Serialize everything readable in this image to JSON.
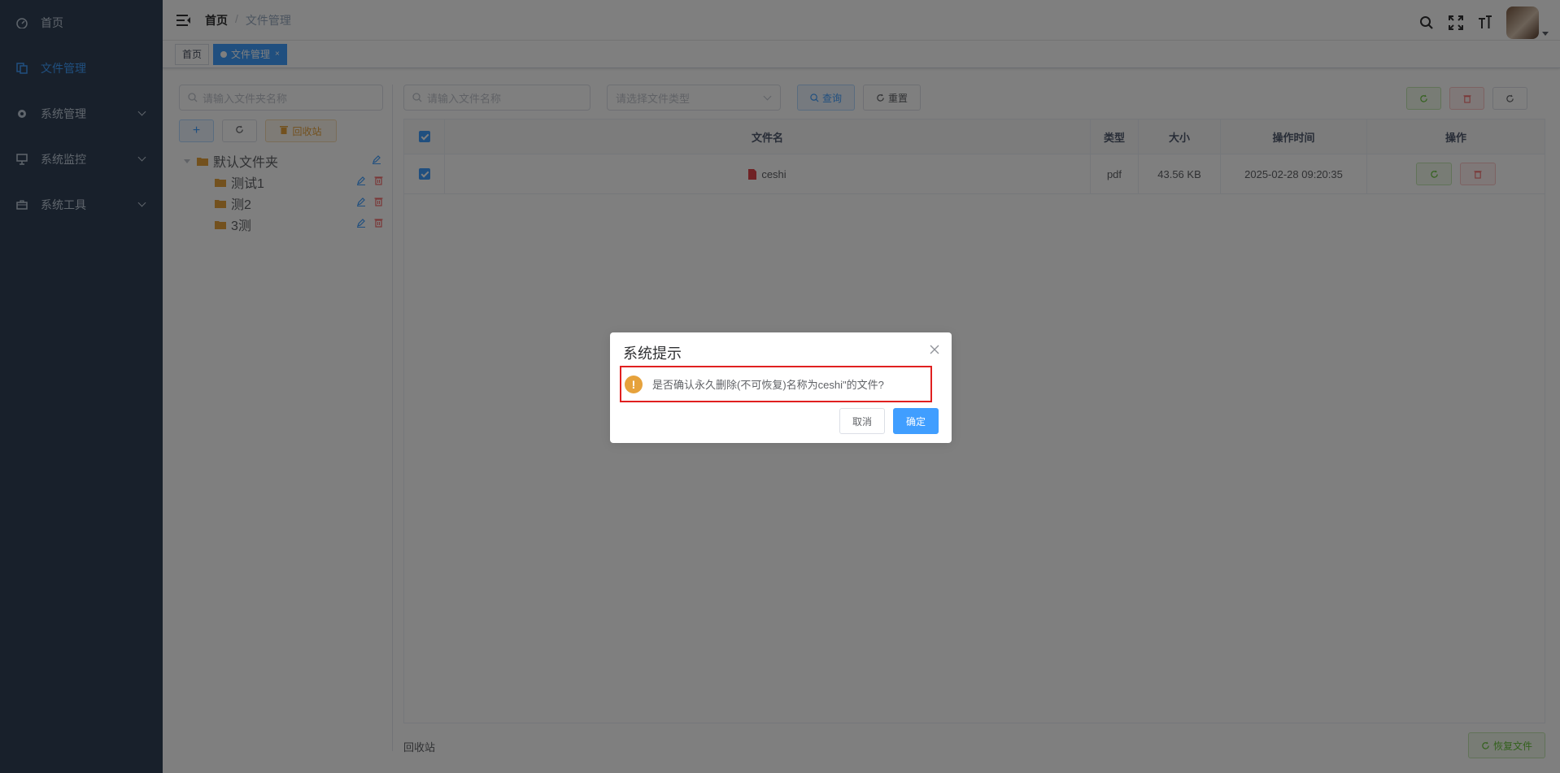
{
  "sidebar": {
    "items": [
      {
        "label": "首页"
      },
      {
        "label": "文件管理"
      },
      {
        "label": "系统管理"
      },
      {
        "label": "系统监控"
      },
      {
        "label": "系统工具"
      }
    ]
  },
  "navbar": {
    "breadcrumb_home": "首页",
    "breadcrumb_sep": "/",
    "breadcrumb_current": "文件管理"
  },
  "tags": {
    "home": "首页",
    "current": "文件管理",
    "close": "×"
  },
  "folder_panel": {
    "search_placeholder": "请输入文件夹名称",
    "recycle_button": "回收站",
    "tree": [
      {
        "label": "默认文件夹"
      },
      {
        "label": "测试1"
      },
      {
        "label": "测2"
      },
      {
        "label": "3测"
      }
    ]
  },
  "toolbar": {
    "file_search_placeholder": "请输入文件名称",
    "type_select_placeholder": "请选择文件类型",
    "query_button": "查询",
    "reset_button": "重置"
  },
  "table": {
    "headers": [
      "文件名",
      "类型",
      "大小",
      "操作时间",
      "操作"
    ],
    "rows": [
      {
        "name": "ceshi",
        "type": "pdf",
        "size": "43.56 KB",
        "time": "2025-02-28 09:20:35"
      }
    ]
  },
  "footer": {
    "recycle_label": "回收站",
    "restore_button": "恢复文件"
  },
  "dialog": {
    "title": "系统提示",
    "message": "是否确认永久删除(不可恢复)名称为ceshi\"的文件?",
    "warn_mark": "!",
    "cancel": "取消",
    "confirm": "确定"
  },
  "colors": {
    "sidebar_bg": "#304156",
    "primary": "#409eff",
    "success": "#67c23a",
    "danger": "#f56c6c",
    "warning": "#e6a23c"
  }
}
